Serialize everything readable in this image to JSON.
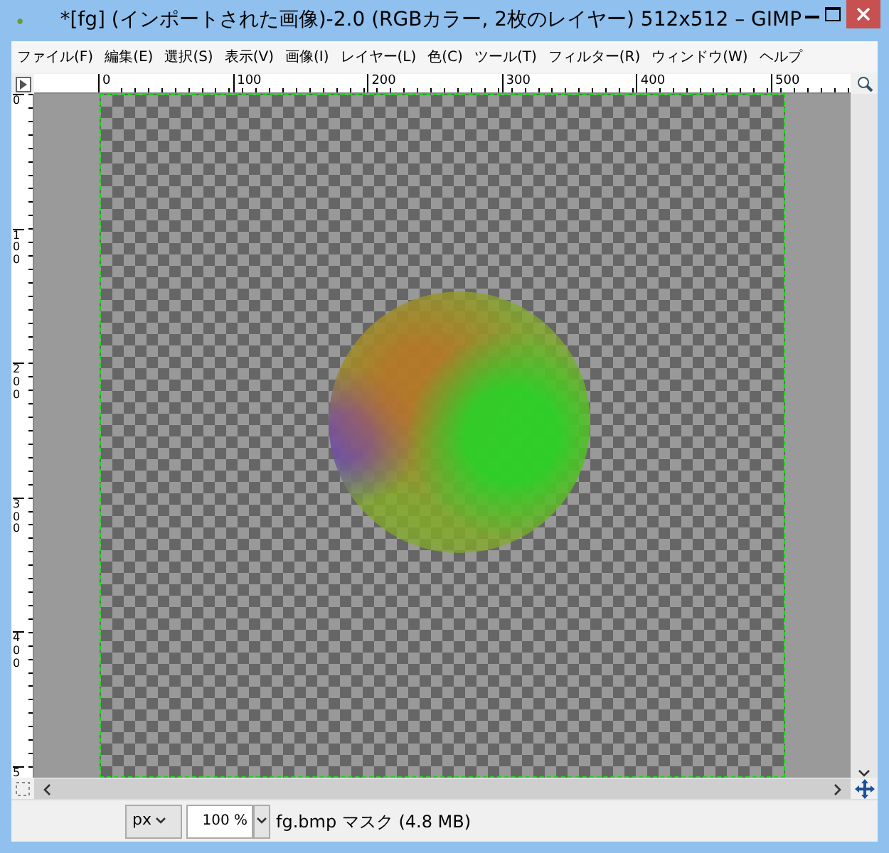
{
  "window": {
    "title": "*[fg] (インポートされた画像)-2.0 (RGBカラー, 2枚のレイヤー) 512x512 – GIMP"
  },
  "menu": [
    {
      "label": "ファイル(F)"
    },
    {
      "label": "編集(E)"
    },
    {
      "label": "選択(S)"
    },
    {
      "label": "表示(V)"
    },
    {
      "label": "画像(I)"
    },
    {
      "label": "レイヤー(L)"
    },
    {
      "label": "色(C)"
    },
    {
      "label": "ツール(T)"
    },
    {
      "label": "フィルター(R)"
    },
    {
      "label": "ウィンドウ(W)"
    },
    {
      "label": "ヘルプ"
    }
  ],
  "rulers": {
    "horizontal": [
      "0",
      "100",
      "200",
      "300",
      "400",
      "500"
    ],
    "vertical": [
      "0",
      "100",
      "200",
      "300",
      "400",
      "5"
    ]
  },
  "status_bar": {
    "unit": "px",
    "zoom": "100 %",
    "message": "fg.bmp マスク (4.8 MB)"
  }
}
